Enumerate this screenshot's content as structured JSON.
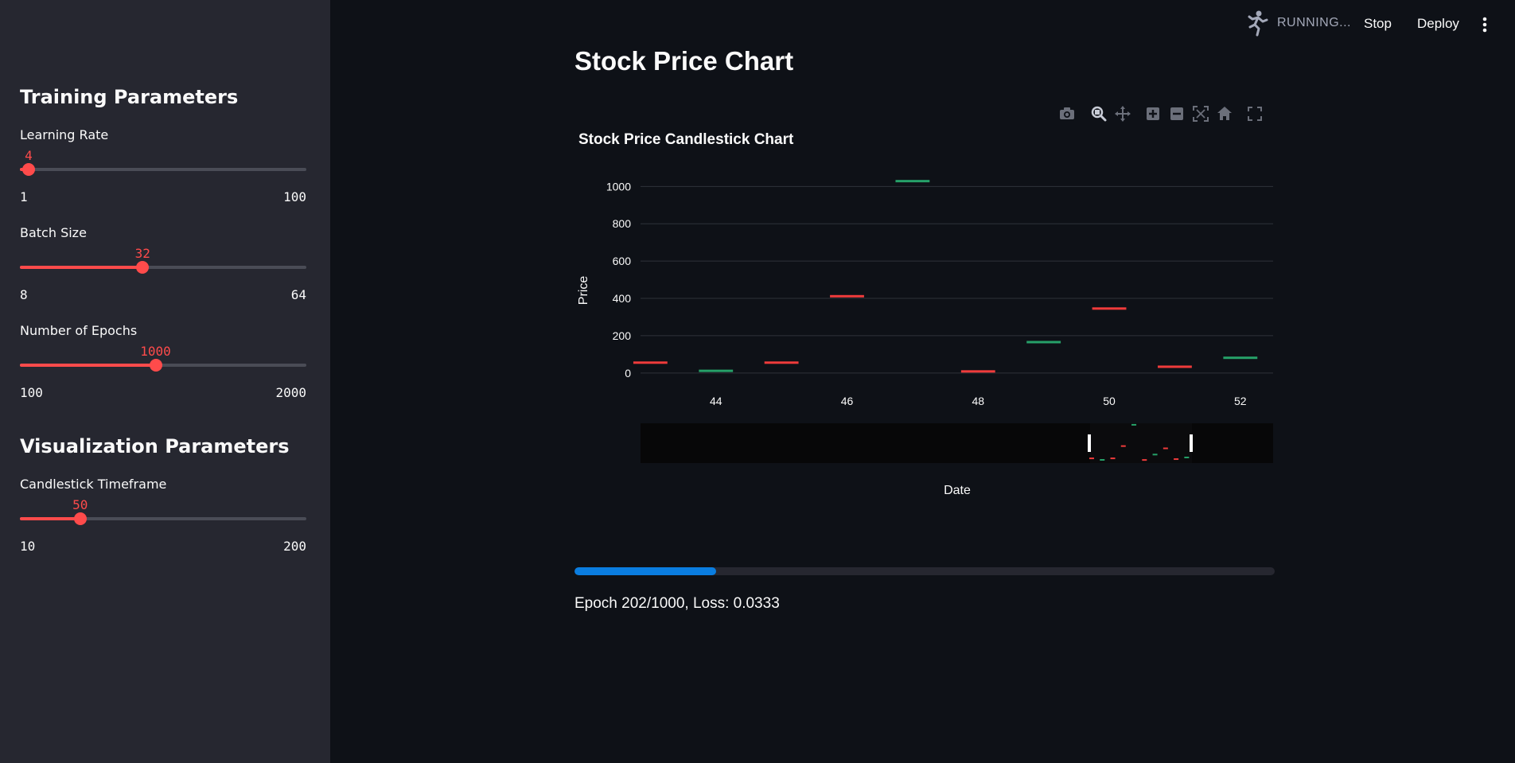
{
  "header": {
    "status": "RUNNING...",
    "stop_label": "Stop",
    "deploy_label": "Deploy",
    "runner_icon": "running-person-icon",
    "menu_icon": "kebab-menu-icon"
  },
  "sidebar": {
    "training_title": "Training Parameters",
    "visualization_title": "Visualization Parameters",
    "sliders": {
      "learning_rate": {
        "label": "Learning Rate",
        "value": 4,
        "min": 1,
        "max": 100
      },
      "batch_size": {
        "label": "Batch Size",
        "value": 32,
        "min": 8,
        "max": 64
      },
      "epochs": {
        "label": "Number of Epochs",
        "value": 1000,
        "min": 100,
        "max": 2000
      },
      "candlestick_timeframe": {
        "label": "Candlestick Timeframe",
        "value": 50,
        "min": 10,
        "max": 200
      }
    }
  },
  "main": {
    "title": "Stock Price Chart",
    "progress_fraction": 0.202,
    "progress_text": "Epoch 202/1000, Loss: 0.0333"
  },
  "modebar": {
    "icons": [
      "camera-icon",
      "zoom-icon",
      "pan-icon",
      "zoom-in-icon",
      "zoom-out-icon",
      "autoscale-icon",
      "reset-axes-icon",
      "fullscreen-icon"
    ]
  },
  "colors": {
    "accent": "#ff4b4b",
    "increasing": "#26a169",
    "decreasing": "#ef3b3b",
    "progress": "#0a7de0",
    "sidebar_bg": "#262730",
    "main_bg": "#0e1117"
  },
  "chart_data": {
    "type": "candlestick",
    "title": "Stock Price Candlestick Chart",
    "xlabel": "Date",
    "ylabel": "Price",
    "xlim": [
      42.85,
      52.5
    ],
    "ylim": [
      -5,
      1010
    ],
    "x_ticks": [
      44,
      46,
      48,
      50,
      52
    ],
    "y_ticks": [
      0,
      200,
      400,
      600,
      800,
      1000
    ],
    "grid": true,
    "rangeslider": true,
    "rangeslider_window": [
      42.85,
      52.5
    ],
    "candles": [
      {
        "x": 43,
        "open": 62,
        "close": 58,
        "dir": "down"
      },
      {
        "x": 44,
        "open": 15,
        "close": 18,
        "dir": "up"
      },
      {
        "x": 45,
        "open": 62,
        "close": 58,
        "dir": "down"
      },
      {
        "x": 46,
        "open": 418,
        "close": 410,
        "dir": "down"
      },
      {
        "x": 47,
        "open": 1030,
        "close": 1035,
        "dir": "up"
      },
      {
        "x": 48,
        "open": 15,
        "close": 12,
        "dir": "down"
      },
      {
        "x": 49,
        "open": 165,
        "close": 172,
        "dir": "up"
      },
      {
        "x": 50,
        "open": 352,
        "close": 340,
        "dir": "down"
      },
      {
        "x": 51,
        "open": 40,
        "close": 35,
        "dir": "down"
      },
      {
        "x": 52,
        "open": 82,
        "close": 88,
        "dir": "up"
      }
    ]
  }
}
